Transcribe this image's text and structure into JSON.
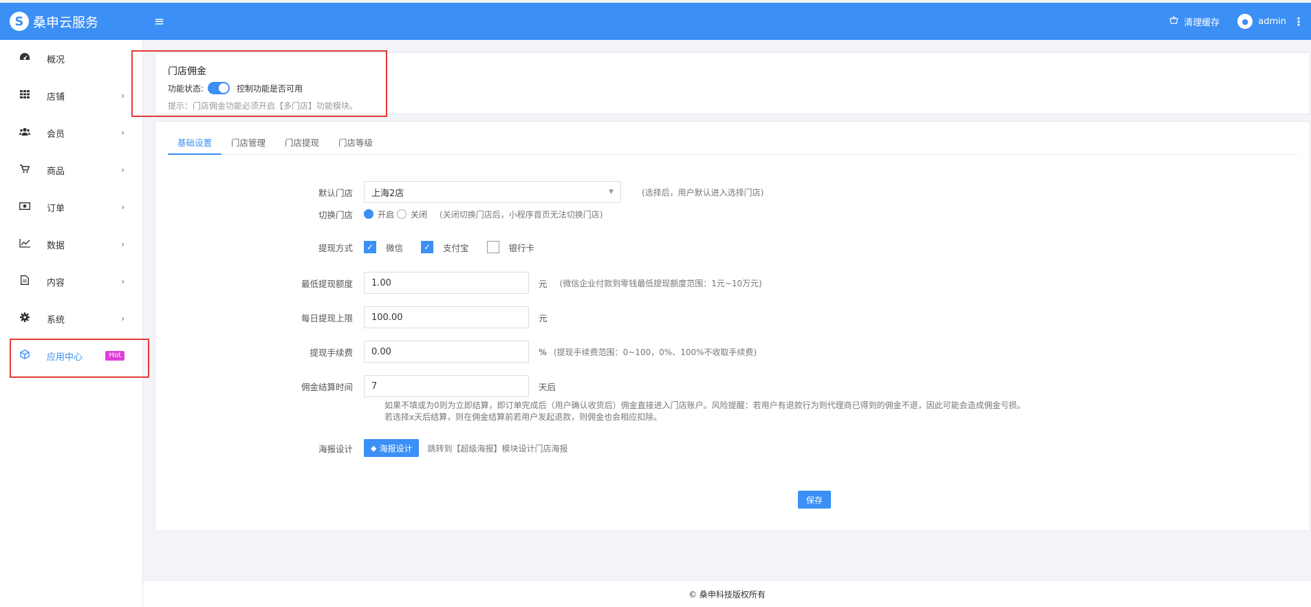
{
  "header": {
    "brand_logo": "S",
    "brand_name": "桑申云服务",
    "menu_icon": "≡",
    "clear_cache": "清理缓存",
    "user_name": "admin"
  },
  "sidebar": {
    "items": [
      {
        "label": "概况",
        "icon": "dashboard-icon"
      },
      {
        "label": "店铺",
        "icon": "grid-icon"
      },
      {
        "label": "会员",
        "icon": "users-icon"
      },
      {
        "label": "商品",
        "icon": "cart-icon"
      },
      {
        "label": "订单",
        "icon": "money-icon"
      },
      {
        "label": "数据",
        "icon": "chart-line-icon"
      },
      {
        "label": "内容",
        "icon": "document-icon"
      },
      {
        "label": "系统",
        "icon": "gear-icon"
      },
      {
        "label": "应用中心",
        "icon": "cube-icon",
        "badge": "Hot"
      }
    ]
  },
  "function_card": {
    "title": "门店佣金",
    "status_label": "功能状态:",
    "status_desc": "控制功能是否可用",
    "tip": "提示：门店佣金功能必须开启【多门店】功能模块。"
  },
  "tabs": [
    "基础设置",
    "门店管理",
    "门店提现",
    "门店等级"
  ],
  "form": {
    "default_store": {
      "label": "默认门店",
      "value": "上海2店",
      "hint": "(选择后，用户默认进入选择门店)"
    },
    "switch_store": {
      "label": "切换门店",
      "on": "开启",
      "off": "关闭",
      "hint": "(关闭切换门店后，小程序首页无法切换门店)"
    },
    "withdraw_method": {
      "label": "提现方式",
      "options": [
        "微信",
        "支付宝",
        "银行卡"
      ]
    },
    "min_amount": {
      "label": "最低提现额度",
      "value": "1.00",
      "unit": "元",
      "hint": "(微信企业付款到零钱最低提现额度范围：1元~10万元)"
    },
    "daily_limit": {
      "label": "每日提现上限",
      "value": "100.00",
      "unit": "元"
    },
    "fee": {
      "label": "提现手续费",
      "value": "0.00",
      "unit": "%",
      "hint": "(提现手续费范围：0~100，0%、100%不收取手续费)"
    },
    "settle_time": {
      "label": "佣金结算时间",
      "value": "7",
      "unit": "天后",
      "note1": "如果不填或为0则为立即结算，即订单完成后（用户确认收货后）佣金直接进入门店账户。风险提醒：若用户有退款行为则代理商已得到的佣金不退，因此可能会造成佣金亏损。",
      "note2": "若选择x天后结算，则在佣金结算前若用户发起退款，则佣金也会相应扣除。"
    },
    "poster": {
      "label": "海报设计",
      "button": "海报设计",
      "hint": "跳转到【超级海报】模块设计门店海报"
    },
    "save": "保存"
  },
  "footer": "© 桑申科技版权所有"
}
